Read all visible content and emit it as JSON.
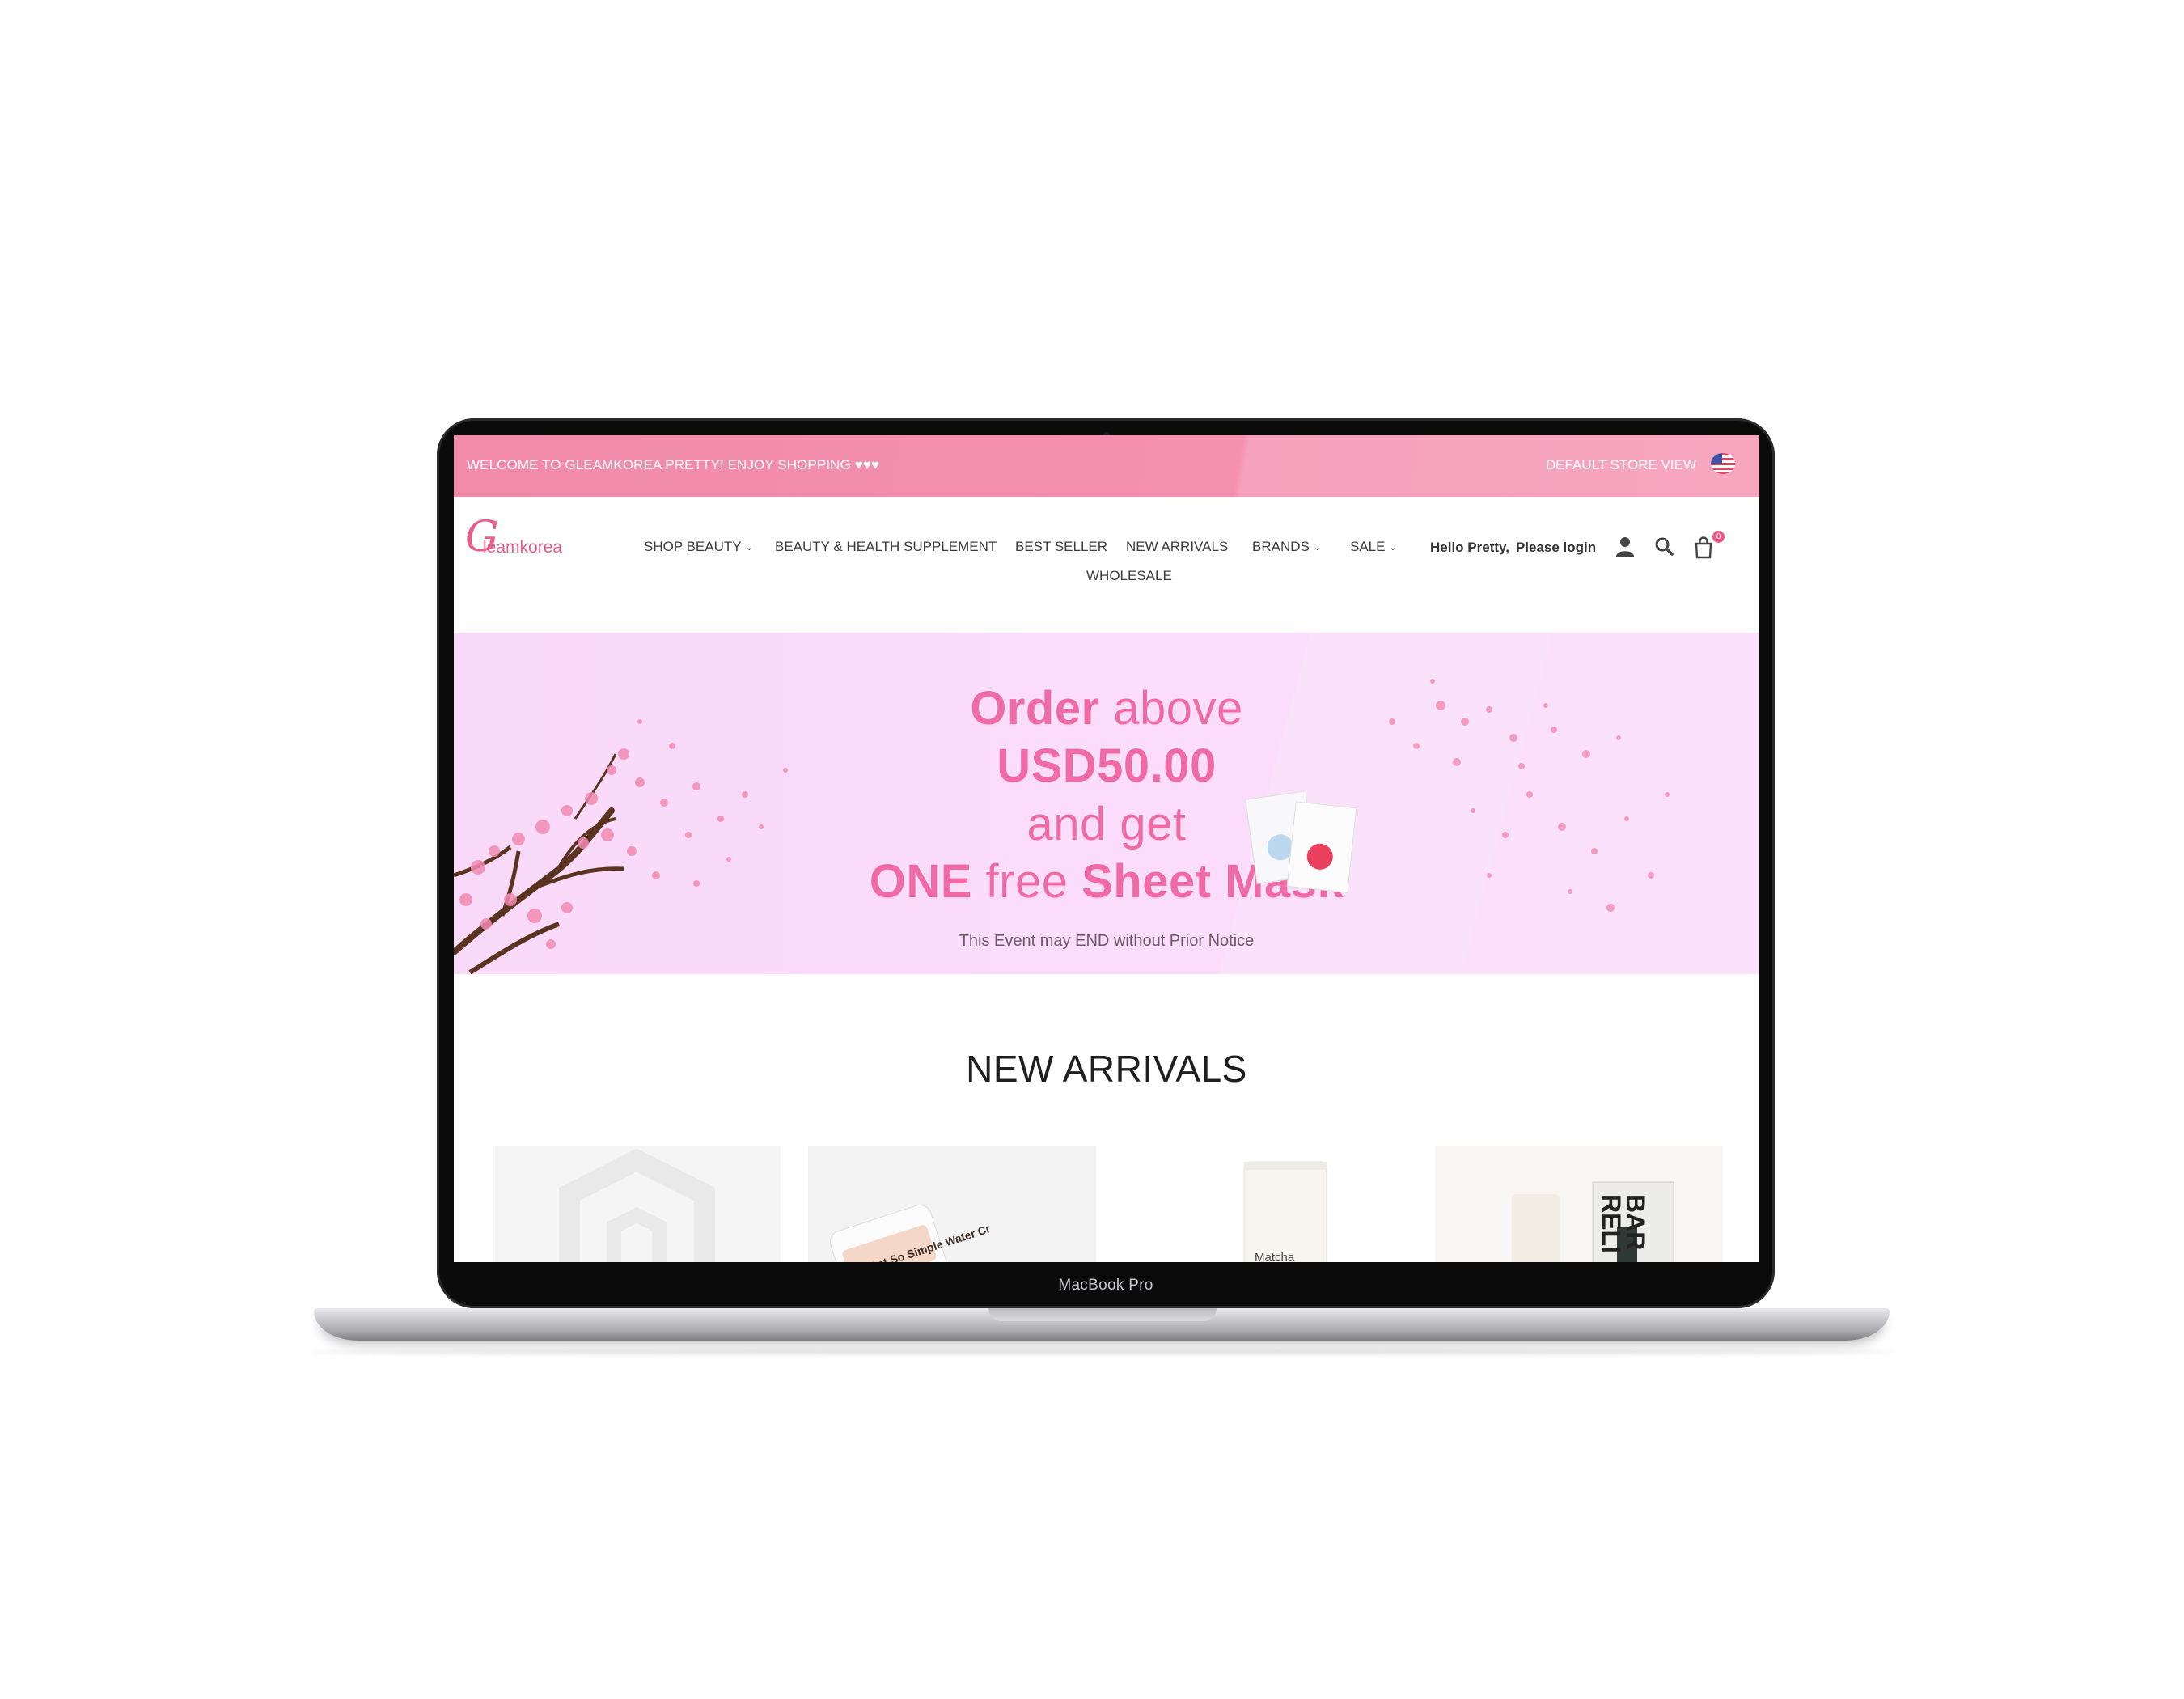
{
  "device": {
    "label": "MacBook Pro"
  },
  "topbar": {
    "welcome": "WELCOME TO GLEAMKOREA PRETTY! ENJOY SHOPPING ♥♥♥",
    "store_view": "DEFAULT STORE VIEW"
  },
  "header": {
    "logo_initial": "G",
    "logo_rest": "leamkorea",
    "nav": {
      "shop_beauty": "SHOP BEAUTY",
      "supplement": "BEAUTY & HEALTH SUPPLEMENT",
      "best_seller": "BEST SELLER",
      "new_arrivals": "NEW ARRIVALS",
      "brands": "BRANDS",
      "sale": "SALE",
      "wholesale": "WHOLESALE"
    },
    "greeting": "Hello Pretty,",
    "login": "Please login",
    "cart_count": "0"
  },
  "banner": {
    "line1a": "Order",
    "line1b": "above",
    "line2": "USD50.00",
    "line3": "and get",
    "line4a": "ONE",
    "line4b": "free",
    "line4c": "Sheet Mask",
    "notice": "This Event may END without Prior Notice"
  },
  "new_arrivals": {
    "title": "NEW ARRIVALS",
    "product_texts": [
      "Oat So Simple Water Cr",
      "Matcha",
      "BAR",
      "RELI"
    ]
  },
  "colors": {
    "accent": "#f28aaa",
    "brand_pink": "#e85d86",
    "banner_bg": "#fbdcfb",
    "promo_text": "#ef6aa6"
  }
}
